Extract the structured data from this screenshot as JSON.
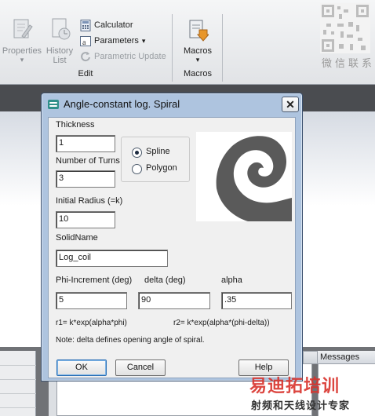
{
  "ribbon": {
    "properties_label": "Properties",
    "history_label_line1": "History",
    "history_label_line2": "List",
    "calculator_label": "Calculator",
    "parameters_label": "Parameters",
    "parameters_arrow": "▾",
    "parametric_update_label": "Parametric Update",
    "edit_group_label": "Edit",
    "macros_label": "Macros",
    "macros_arrow": "▾",
    "macros_group_label": "Macros",
    "properties_arrow": "▾",
    "qr_caption": "微信联系"
  },
  "panels": {
    "messages_title": "Messages"
  },
  "dialog": {
    "title": "Angle-constant log. Spiral",
    "close_glyph": "✕",
    "thickness_label": "Thickness",
    "thickness_value": "1",
    "turns_label": "Number of Turns",
    "turns_value": "3",
    "radius_label": "Initial Radius (=k)",
    "radius_value": "10",
    "solidname_label": "SolidName",
    "solidname_value": "Log_coil",
    "spline_label": "Spline",
    "polygon_label": "Polygon",
    "selected_mode": "Spline",
    "phi_label": "Phi-Increment (deg)",
    "phi_value": "5",
    "delta_label": "delta (deg)",
    "delta_value": "90",
    "alpha_label": "alpha",
    "alpha_value": ".35",
    "formula_r1": "r1= k*exp(alpha*phi)",
    "formula_r2": "r2= k*exp(alpha*(phi-delta))",
    "note": "Note: delta defines opening angle of spiral.",
    "ok_label": "OK",
    "cancel_label": "Cancel",
    "help_label": "Help"
  },
  "watermark": {
    "line1": "易迪拓培训",
    "line2": "射频和天线设计专家"
  },
  "colors": {
    "title_bar": "#aec4df",
    "dialog_body": "#f0f0f0",
    "spiral": "#5a5a5a",
    "watermark": "#d9332c"
  }
}
